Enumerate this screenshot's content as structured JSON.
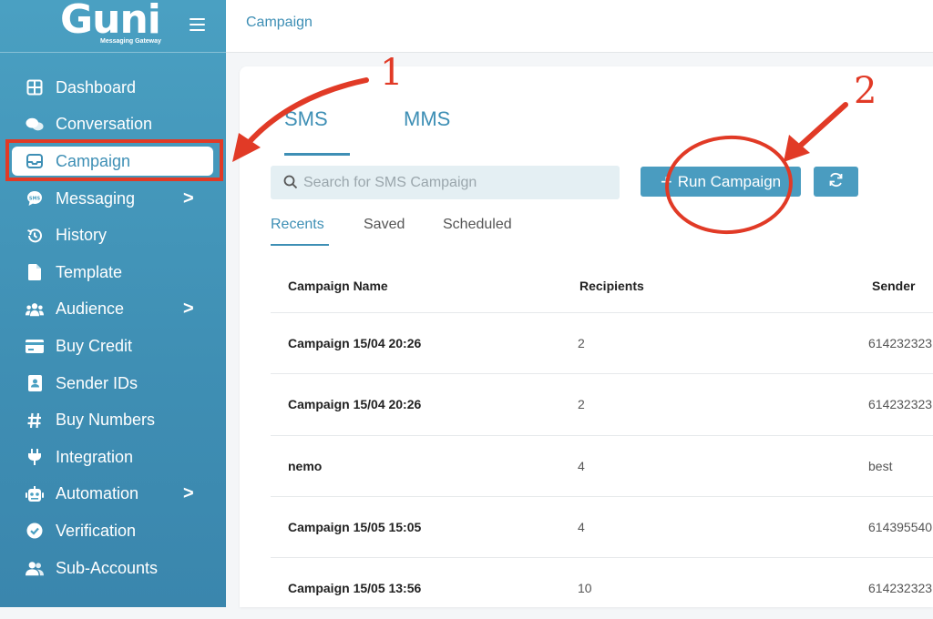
{
  "brand": {
    "logo_text": "Guni",
    "tagline": "Messaging Gateway"
  },
  "header": {
    "breadcrumb": "Campaign"
  },
  "sidebar": {
    "items": [
      {
        "label": "Dashboard",
        "icon": "dashboard-icon"
      },
      {
        "label": "Conversation",
        "icon": "chat-icon"
      },
      {
        "label": "Campaign",
        "icon": "inbox-icon",
        "active": true
      },
      {
        "label": "Messaging",
        "icon": "sms-icon",
        "chevron": ">"
      },
      {
        "label": "History",
        "icon": "history-icon"
      },
      {
        "label": "Template",
        "icon": "file-icon"
      },
      {
        "label": "Audience",
        "icon": "users-icon",
        "chevron": ">"
      },
      {
        "label": "Buy Credit",
        "icon": "credit-card-icon"
      },
      {
        "label": "Sender IDs",
        "icon": "id-card-icon"
      },
      {
        "label": "Buy Numbers",
        "icon": "hash-icon"
      },
      {
        "label": "Integration",
        "icon": "plug-icon"
      },
      {
        "label": "Automation",
        "icon": "robot-icon",
        "chevron": ">"
      },
      {
        "label": "Verification",
        "icon": "check-circle-icon"
      },
      {
        "label": "Sub-Accounts",
        "icon": "user-group-icon"
      }
    ]
  },
  "main": {
    "tabs": [
      {
        "label": "SMS"
      },
      {
        "label": "MMS"
      }
    ],
    "search": {
      "placeholder": "Search for SMS Campaign"
    },
    "run_button": {
      "label": "Run Campaign",
      "icon": "plus-icon"
    },
    "refresh_button": {
      "icon": "refresh-icon"
    },
    "subtabs": [
      {
        "label": "Recents"
      },
      {
        "label": "Saved"
      },
      {
        "label": "Scheduled"
      }
    ],
    "table": {
      "columns": [
        "Campaign Name",
        "Recipients",
        "Sender"
      ],
      "rows": [
        [
          "Campaign 15/04 20:26",
          "2",
          "614232323"
        ],
        [
          "Campaign 15/04 20:26",
          "2",
          "614232323"
        ],
        [
          "nemo",
          "4",
          "best"
        ],
        [
          "Campaign 15/05 15:05",
          "4",
          "614395540"
        ],
        [
          "Campaign 15/05 13:56",
          "10",
          "614232323"
        ]
      ]
    }
  },
  "annotations": {
    "step1": "1",
    "step2": "2"
  },
  "colors": {
    "accent": "#3e8fb5",
    "sidebar": "#4aa0c2",
    "annotation": "#e13a26"
  }
}
